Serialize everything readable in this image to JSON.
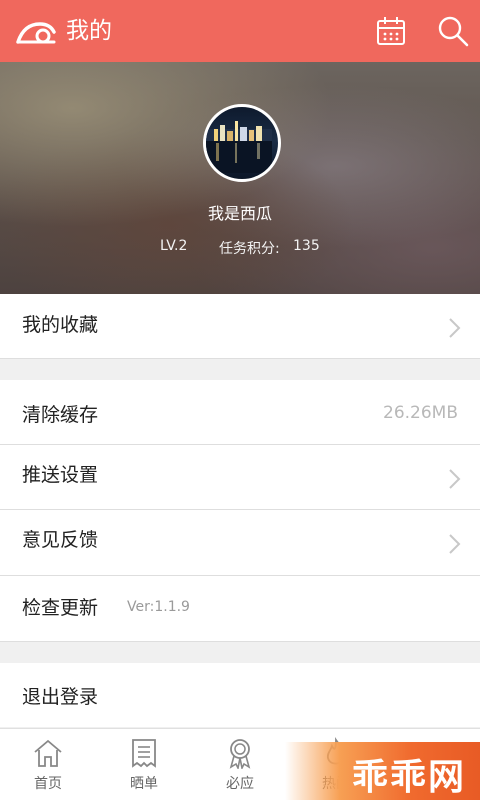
{
  "header": {
    "title": "我的",
    "calendar_icon": "calendar-icon",
    "search_icon": "search-icon",
    "background": "#f0685d"
  },
  "profile": {
    "username": "我是西瓜",
    "level": "LV.2",
    "points_label": "任务积分:",
    "points_value": "135"
  },
  "menu": {
    "favorites": {
      "label": "我的收藏"
    },
    "clear_cache": {
      "label": "清除缓存",
      "size": "26.26MB"
    },
    "push_settings": {
      "label": "推送设置"
    },
    "feedback": {
      "label": "意见反馈"
    },
    "check_update": {
      "label": "检查更新",
      "version": "Ver:1.1.9"
    },
    "logout": {
      "label": "退出登录"
    }
  },
  "tabs": [
    {
      "label": "首页",
      "icon": "home-icon"
    },
    {
      "label": "晒单",
      "icon": "receipt-icon"
    },
    {
      "label": "必应",
      "icon": "badge-icon"
    },
    {
      "label": "热门",
      "icon": "flame-icon"
    }
  ],
  "watermark": {
    "text": "乖乖网"
  }
}
